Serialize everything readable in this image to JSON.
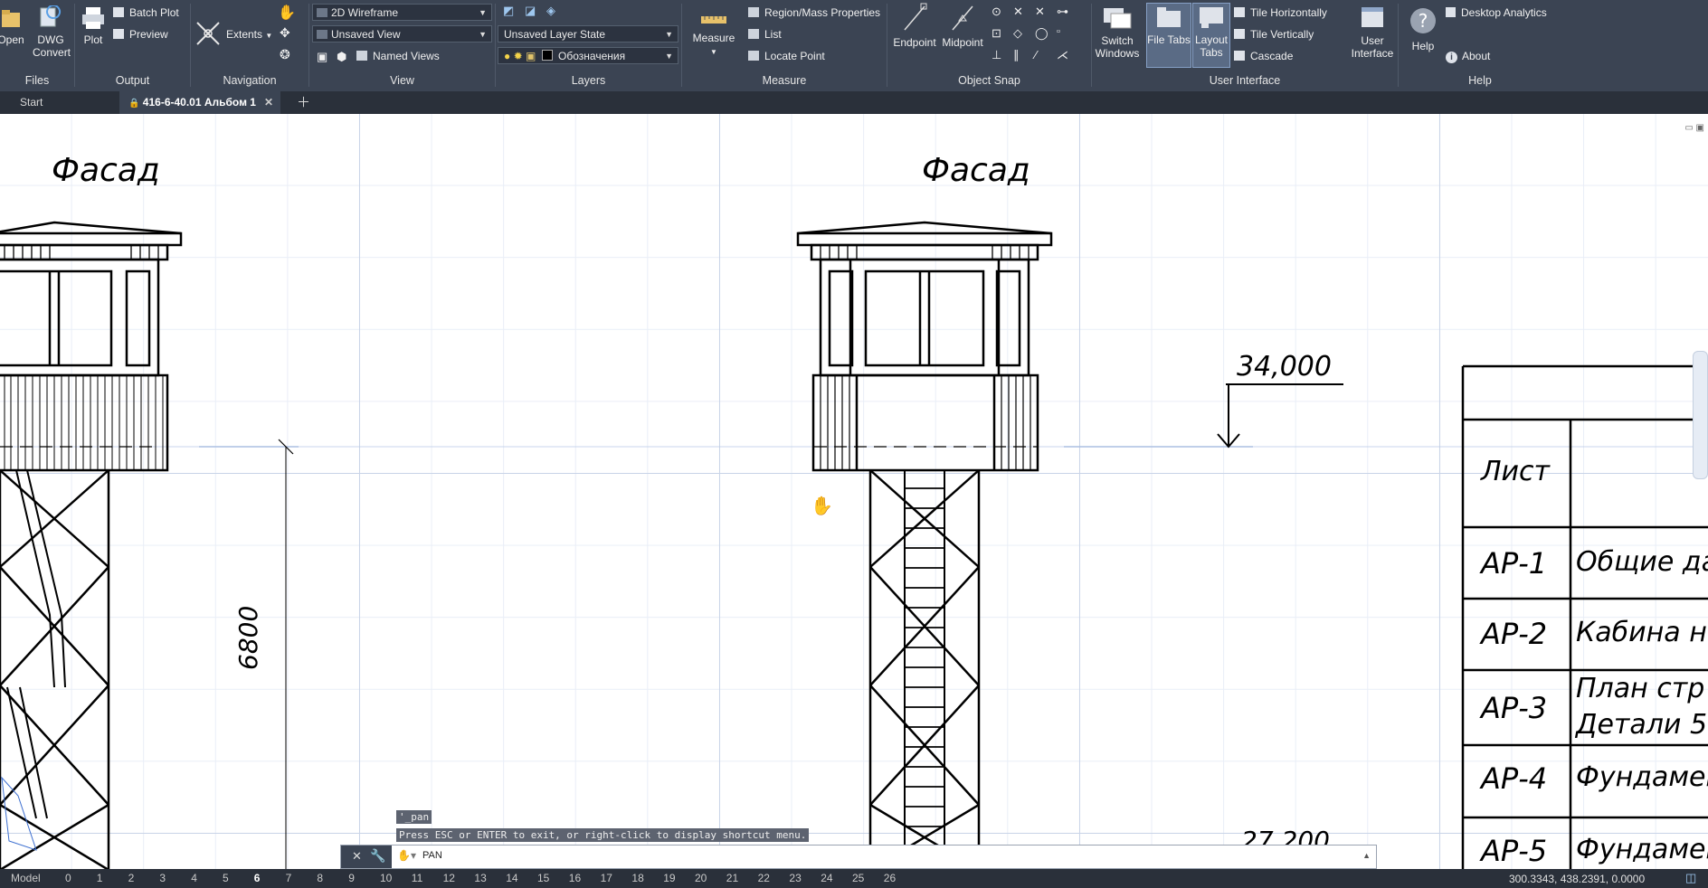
{
  "ribbon": {
    "files": {
      "open_label": "Open",
      "dwg_convert_label": "DWG\nConvert",
      "title": "Files"
    },
    "output": {
      "plot_label": "Plot",
      "batch_plot_label": "Batch Plot",
      "preview_label": "Preview",
      "title": "Output"
    },
    "navigation": {
      "extents_label": "Extents",
      "title": "Navigation"
    },
    "view": {
      "visual_style": "2D Wireframe",
      "view_state": "Unsaved View",
      "named_views_label": "Named Views",
      "title": "View"
    },
    "layers": {
      "layer_state": "Unsaved Layer State",
      "current_layer": "Обозначения",
      "title": "Layers"
    },
    "measure": {
      "measure_label": "Measure",
      "region_mass_label": "Region/Mass Properties",
      "list_label": "List",
      "locate_point_label": "Locate Point",
      "title": "Measure"
    },
    "object_snap": {
      "endpoint_label": "Endpoint",
      "midpoint_label": "Midpoint",
      "title": "Object Snap"
    },
    "user_interface": {
      "switch_windows_label": "Switch\nWindows",
      "file_tabs_label": "File Tabs",
      "layout_tabs_label": "Layout\nTabs",
      "tile_horizontally_label": "Tile Horizontally",
      "tile_vertically_label": "Tile Vertically",
      "cascade_label": "Cascade",
      "user_interface_label": "User\nInterface",
      "title": "User Interface"
    },
    "help": {
      "help_label": "Help",
      "desktop_analytics_label": "Desktop Analytics",
      "about_label": "About",
      "title": "Help"
    }
  },
  "tabs": {
    "start_label": "Start",
    "drawing_label": "416-6-40.01 Альбом 1"
  },
  "drawing": {
    "facade_title_left": "Фасад",
    "facade_title_right": "Фасад",
    "elevation_top": "34,000",
    "elevation_bottom": "27,200",
    "dimension_height": "6800",
    "table_header": "Лист",
    "sheets": [
      {
        "code": "АР-1",
        "name": "Общие да"
      },
      {
        "code": "АР-2",
        "name": "Кабина н"
      },
      {
        "code": "АР-3",
        "name": "План стр",
        "name2": "Детали 5"
      },
      {
        "code": "АР-4",
        "name": "Фундамен"
      },
      {
        "code": "АР-5",
        "name": "Фундамен"
      }
    ]
  },
  "command": {
    "history_line1": "'_pan",
    "history_line2": "Press ESC or ENTER to exit, or right-click to display shortcut menu.",
    "current": "PAN"
  },
  "status": {
    "model_label": "Model",
    "layouts": [
      "0",
      "1",
      "2",
      "3",
      "4",
      "5",
      "6",
      "7",
      "8",
      "9",
      "10",
      "11",
      "12",
      "13",
      "14",
      "15",
      "16",
      "17",
      "18",
      "19",
      "20",
      "21",
      "22",
      "23",
      "24",
      "25",
      "26"
    ],
    "active_layout": "6",
    "coordinates": "300.3343, 438.2391, 0.0000"
  }
}
